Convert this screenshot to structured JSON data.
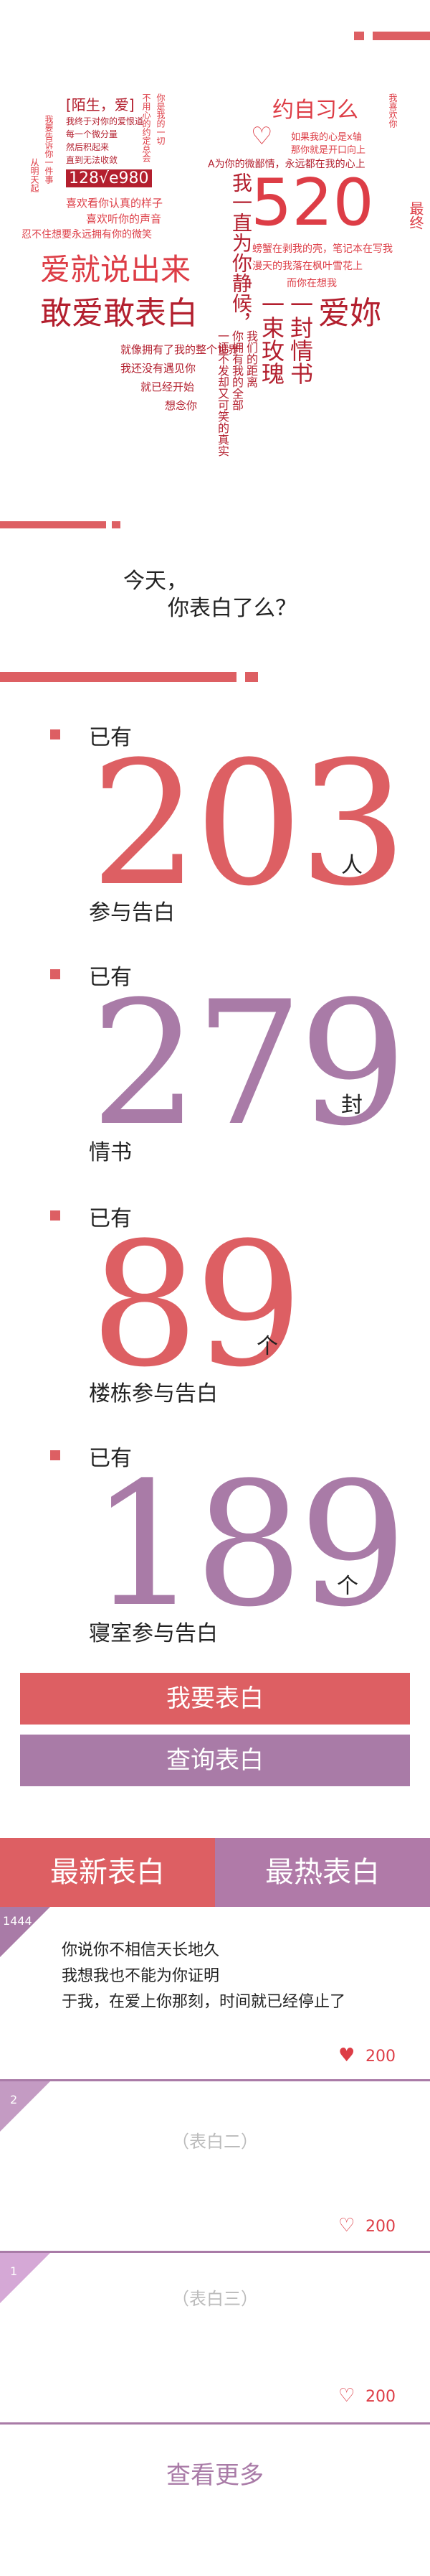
{
  "colors": {
    "accent_red": "#dd5f63",
    "accent_purple": "#a97ba7",
    "tab_red": "#dd5f63",
    "tab_purple": "#b07aa8"
  },
  "hero": {
    "pieces": [
      "[陌生，爱]",
      "约自习么",
      "我终于对你的爱恨道",
      "每一个微分量",
      "然后积起来",
      "直到无法收敛",
      "128√e980",
      "喜欢看你认真的样子",
      "喜欢听你的声音",
      "忍不住想要永远拥有你的微笑",
      "我一直为你静候，",
      "520",
      "一封情书",
      "一束玫瑰",
      "爱妳",
      "爱就说出来",
      "敢爱敢表白",
      "就像拥有了我的整个世界",
      "我还没有遇见你",
      "就已经开始",
      "想念你",
      "A为你的微鄙情，永远都在我的心上",
      "如果我的心是x轴",
      "那你就是开口向上",
      "螃蟹在剥我的壳，笔记本在写我",
      "漫天的我落在枫叶雪花上",
      "而你在想我",
      "最终",
      "你拥有我的全部",
      "我们的距离",
      "一语不发却又可笑的真实",
      "不用心的约定总会",
      "你是我的一切",
      "从明天起",
      "我要告诉你一件事",
      "我喜欢你"
    ]
  },
  "question": {
    "line1": "今天，",
    "line2": "你表白了么？"
  },
  "stats": [
    {
      "prefix": "已有",
      "number": "203",
      "unit": "人",
      "label": "参与告白",
      "color": "#dd5f63"
    },
    {
      "prefix": "已有",
      "number": "279",
      "unit": "封",
      "label": "情书",
      "color": "#a97ba7"
    },
    {
      "prefix": "已有",
      "number": "89",
      "unit": "个",
      "label": "楼栋参与告白",
      "color": "#dd5f63"
    },
    {
      "prefix": "已有",
      "number": "189",
      "unit": "个",
      "label": "寝室参与告白",
      "color": "#a97ba7"
    }
  ],
  "buttons": {
    "confess": "我要表白",
    "query": "查询表白"
  },
  "tabs": {
    "latest": "最新表白",
    "hottest": "最热表白"
  },
  "cards": [
    {
      "id": "1444",
      "lines": [
        "你说你不相信天长地久",
        "我想我也不能为你证明",
        "于我，在爱上你那刻，时间就已经停止了"
      ],
      "likes": "200"
    },
    {
      "id": "2",
      "placeholder": "（表白二）",
      "likes": "200"
    },
    {
      "id": "1",
      "placeholder": "（表白三）",
      "likes": "200"
    }
  ],
  "more": "查看更多"
}
